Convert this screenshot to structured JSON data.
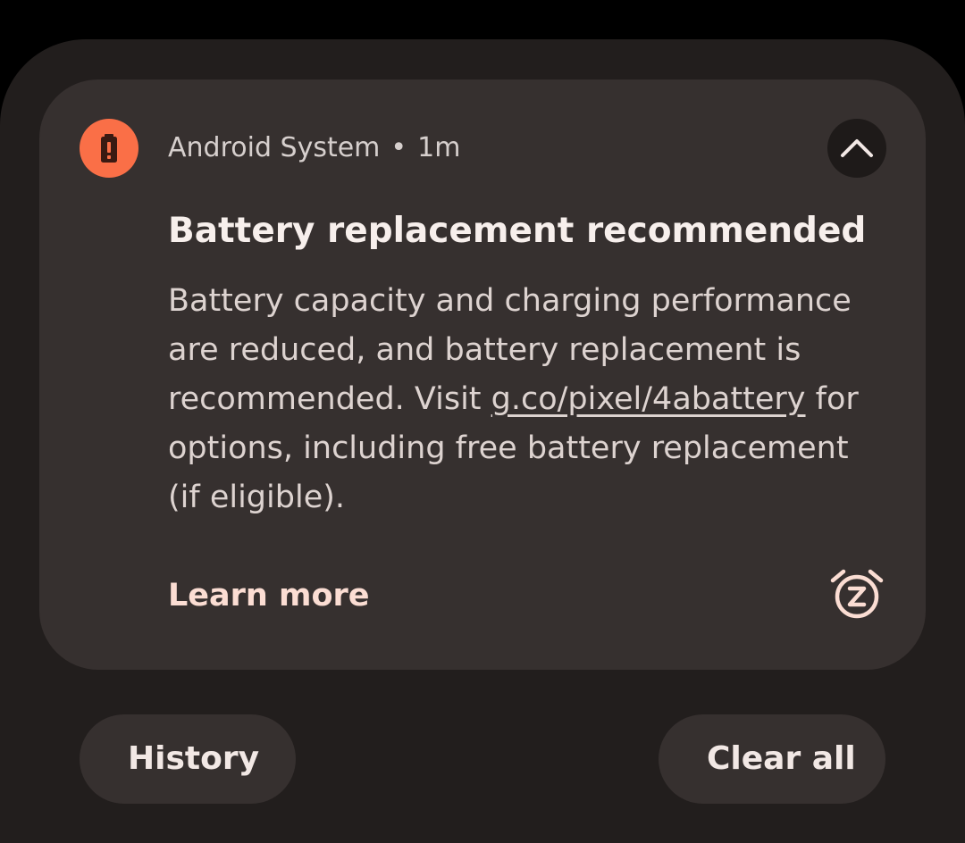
{
  "notification": {
    "app_name": "Android System",
    "separator": "•",
    "time": "1m",
    "title": "Battery replacement recommended",
    "body_before_link": "Battery capacity and charging performance are reduced, and battery replacement is recommended. Visit ",
    "body_link": "g.co/pixel/4abattery",
    "body_after_link": " for options, including free battery replacement (if eligible).",
    "action_label": "Learn more",
    "app_icon": "battery-alert-icon",
    "collapse_icon": "chevron-up-icon",
    "snooze_icon": "snooze-alarm-icon"
  },
  "footer": {
    "history_label": "History",
    "clear_all_label": "Clear all"
  },
  "colors": {
    "background": "#000000",
    "shade": "#221e1d",
    "card": "#36302f",
    "icon_accent": "#fa6f47",
    "action_text": "#fbddd3"
  }
}
